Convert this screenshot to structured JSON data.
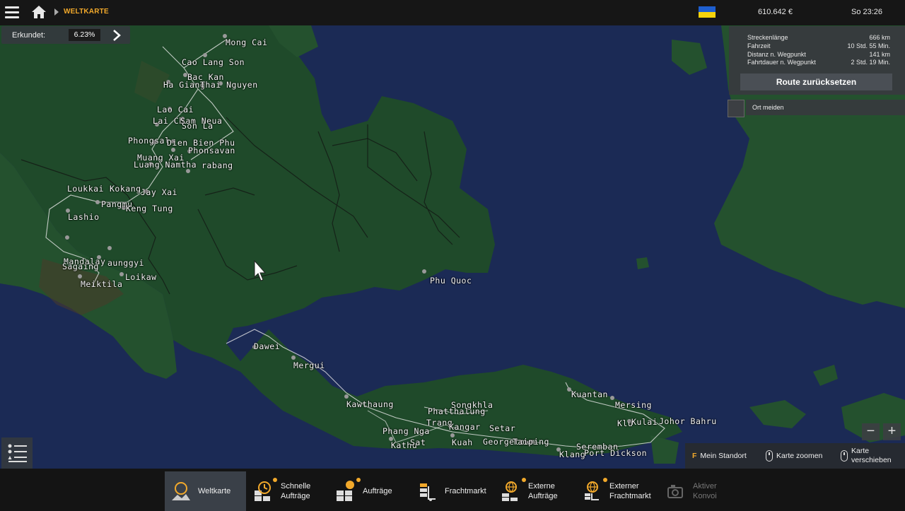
{
  "header": {
    "breadcrumb": "WELTKARTE",
    "money": "610.642 €",
    "time": "So 23:26",
    "flag_colors": [
      "#1e5fd0",
      "#f5d20c"
    ],
    "accent_color": "#f2a92b"
  },
  "explored": {
    "label": "Erkundet:",
    "value": "6.23%"
  },
  "route": {
    "rows": [
      {
        "label": "Streckenlänge",
        "value": "666 km"
      },
      {
        "label": "Fahrzeit",
        "value": "10 Std. 55 Min."
      },
      {
        "label": "Distanz n. Wegpunkt",
        "value": "141 km"
      },
      {
        "label": "Fahrtdauer n. Wegpunkt",
        "value": "2 Std. 19 Min."
      }
    ],
    "reset_button": "Route zurücksetzen",
    "avoid_label": "Ort meiden"
  },
  "zoom": {
    "minus": "−",
    "plus": "+"
  },
  "hints": {
    "my_location_key": "F",
    "my_location": "Mein Standort",
    "zoom_map": "Karte zoomen",
    "move_map_line1": "Karte",
    "move_map_line2": "verschieben"
  },
  "cities": {
    "mong_cai": "Mong Cai",
    "cao_lang_son": "Cao Lang Son",
    "bac_kan": "Bac Kan",
    "ha_giang": "Ha Giang",
    "thai_nguyen": "Thai Nguyen",
    "lao_cai": "Lao Cai",
    "lai_chau": "Lai Ch",
    "sam_neua": "Sam Neua",
    "son_la": "Son La",
    "phongsali": "Phongsal",
    "dien_bien_phu": "Dien Bien Phu",
    "phonsavan": "Phonsavan",
    "muang_xai": "Muang Xai",
    "luang_namtha": "Luang Namtha",
    "luang_prabang": "rabang",
    "loukkai": "Loukkai",
    "kokang": "Kokang",
    "jay_xai": "Jay Xai",
    "pangmu": "Pangmu",
    "keng_tung": "Keng Tung",
    "lashio": "Lashio",
    "mandalay": "Mandalay",
    "taunggyi": "aunggyi",
    "sagaing": "Sagaing",
    "loikaw": "Loikaw",
    "meiktila": "Meiktila",
    "phu_quoc": "Phu Quoc",
    "dawei": "Dawei",
    "mergui": "Mergui",
    "kawthaung": "Kawthaung",
    "songkhla": "Songkhla",
    "phatthalung": "Phatthalung",
    "trang": "Trang",
    "phang_nga": "Phang Nga",
    "kathu": "Kathu",
    "satun": "Sat",
    "kangar": "Kangar",
    "setar": "Setar",
    "kuah": "Kuah",
    "georgetown": "Georgetown",
    "taiping": "Taiping",
    "kuantan": "Kuantan",
    "mersing": "Mersing",
    "kuala_lumpur": "Klu",
    "kulai": "Kulai",
    "johor_bahru": "Johor Bahru",
    "seremban": "Seremban",
    "klang": "Klang",
    "port_dickson": "Port Dickson"
  },
  "nav": [
    {
      "line1": "Weltkarte",
      "line2": "",
      "active": true,
      "dot": false,
      "icon": "globe-map-icon",
      "disabled": false
    },
    {
      "line1": "Schnelle",
      "line2": "Aufträge",
      "active": false,
      "dot": true,
      "icon": "clock-boxes-icon",
      "disabled": false
    },
    {
      "line1": "Aufträge",
      "line2": "",
      "active": false,
      "dot": true,
      "icon": "boxes-icon",
      "disabled": false
    },
    {
      "line1": "Frachtmarkt",
      "line2": "",
      "active": false,
      "dot": false,
      "icon": "cargo-market-icon",
      "disabled": false
    },
    {
      "line1": "Externe",
      "line2": "Aufträge",
      "active": false,
      "dot": true,
      "icon": "globe-boxes-icon",
      "disabled": false
    },
    {
      "line1": "Externer",
      "line2": "Frachtmarkt",
      "active": false,
      "dot": true,
      "icon": "globe-cargo-icon",
      "disabled": false
    },
    {
      "line1": "Aktiver",
      "line2": "Konvoi",
      "active": false,
      "dot": false,
      "icon": "convoy-icon",
      "disabled": true
    }
  ]
}
